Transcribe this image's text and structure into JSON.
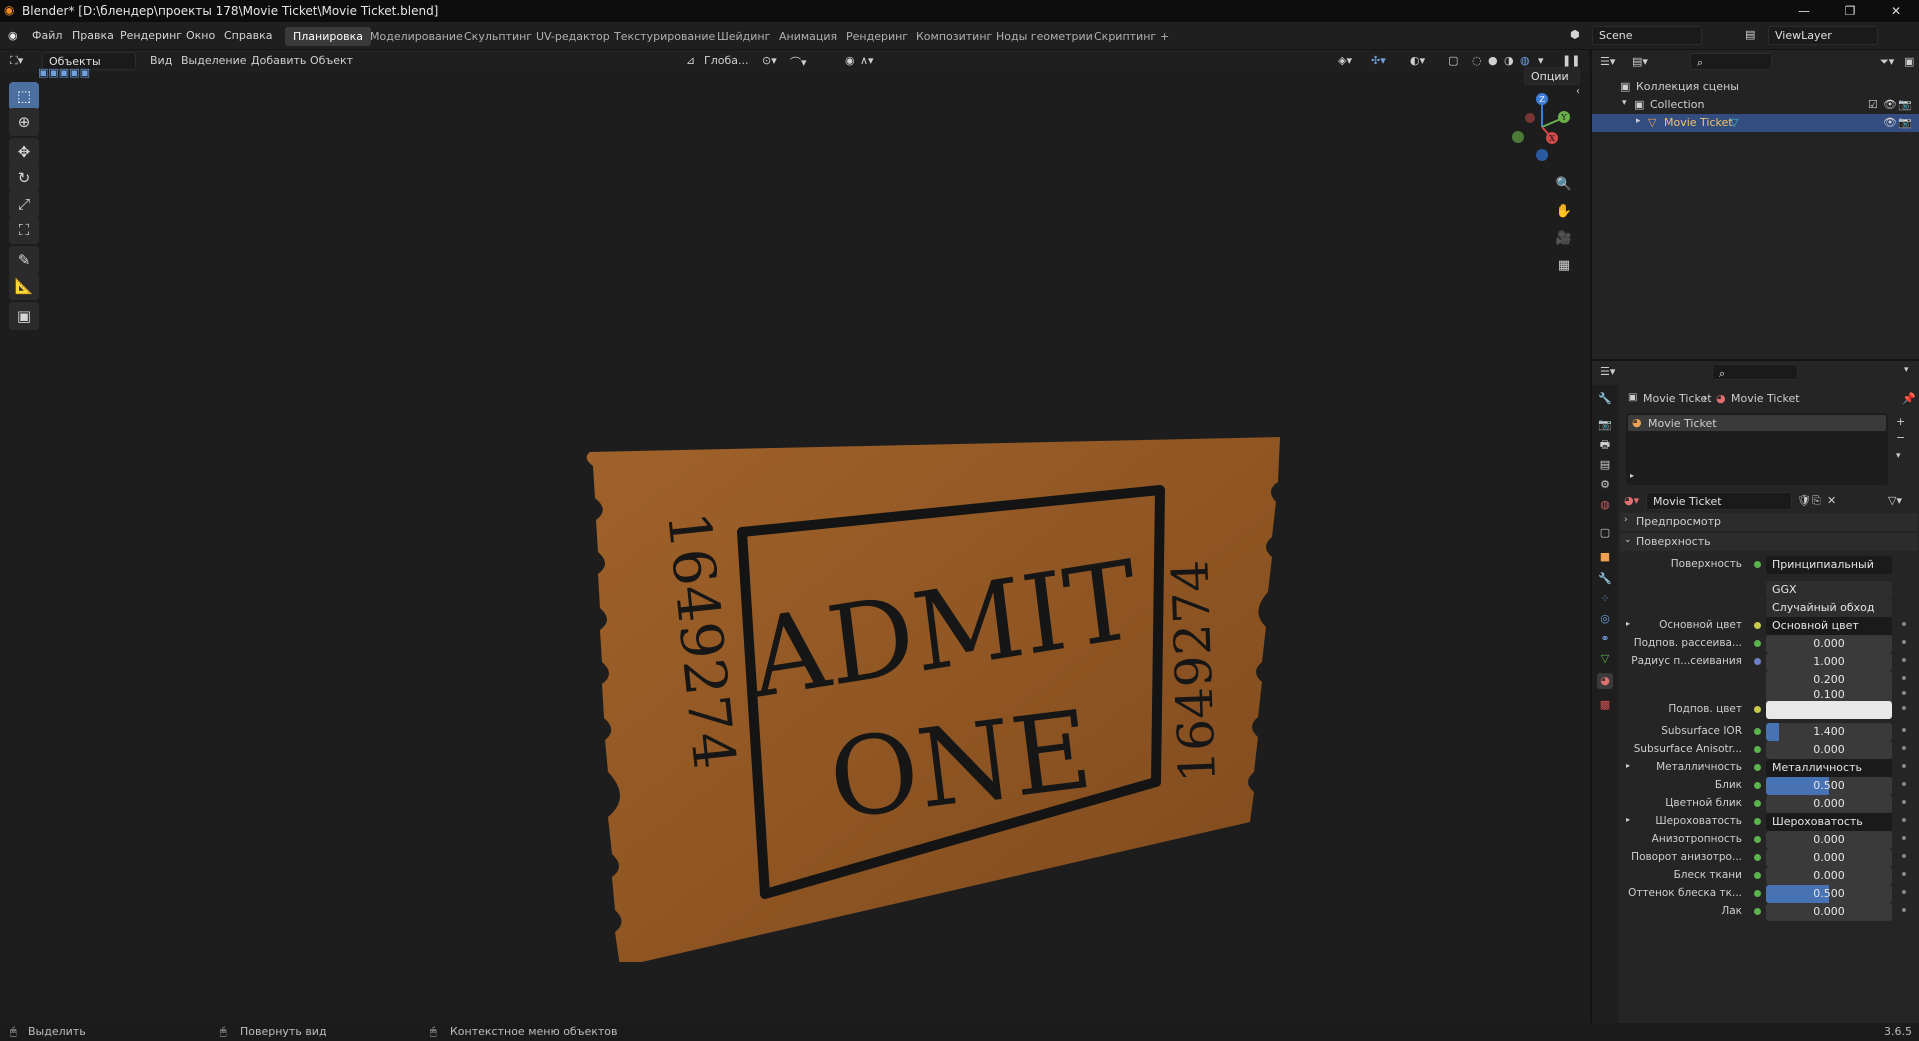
{
  "window": {
    "title": "Blender* [D:\\блендер\\проекты 178\\Movie Ticket\\Movie Ticket.blend]",
    "controls": [
      "—",
      "❐",
      "✕"
    ]
  },
  "menu": [
    "Файл",
    "Правка",
    "Рендеринг",
    "Окно",
    "Справка"
  ],
  "workspaces": [
    "Планировка",
    "Моделирование",
    "Скульптинг",
    "UV-редактор",
    "Текстурирование",
    "Шейдинг",
    "Анимация",
    "Рендеринг",
    "Композитинг",
    "Ноды геометрии",
    "Скриптинг",
    "+"
  ],
  "active_workspace": "Планировка",
  "scene": {
    "name": "Scene",
    "view_layer": "ViewLayer"
  },
  "viewport_header": {
    "mode": "Объекты",
    "menus": [
      "Вид",
      "Выделение",
      "Добавить",
      "Объект"
    ],
    "transform_orientation": "Глоба...",
    "options": "Опции"
  },
  "tools": [
    {
      "name": "select-box-tool",
      "glyph": "⬚"
    },
    {
      "name": "cursor-tool",
      "glyph": "⊕"
    },
    {
      "name": "move-tool",
      "glyph": "✥"
    },
    {
      "name": "rotate-tool",
      "glyph": "↻"
    },
    {
      "name": "scale-tool",
      "glyph": "⤢"
    },
    {
      "name": "transform-tool",
      "glyph": "⛶"
    },
    {
      "name": "annotate-tool",
      "glyph": "✎"
    },
    {
      "name": "measure-tool",
      "glyph": "📐"
    },
    {
      "name": "add-cube-tool",
      "glyph": "▣"
    }
  ],
  "ticket": {
    "main_text_1": "ADMIT",
    "main_text_2": "ONE",
    "serial_left": "1649274",
    "serial_right": "1649274",
    "color": "#9b5a24"
  },
  "gizmo": {
    "z": "Z",
    "y": "Y",
    "x": "X"
  },
  "outliner": {
    "root": "Коллекция сцены",
    "collection": "Collection",
    "object": "Movie Ticket"
  },
  "properties": {
    "breadcrumb_object": "Movie Ticket",
    "breadcrumb_material": "Movie Ticket",
    "slot": "Movie Ticket",
    "material_name": "Movie Ticket",
    "preview_label": "Предпросмотр",
    "surface_label": "Поверхность",
    "surface_shader_label": "Поверхность",
    "surface_shader": "Принципиальный BSDF",
    "distribution": "GGX",
    "subsurface_method": "Случайный обход",
    "rows": [
      {
        "label": "Основной цвет",
        "value": "Основной цвет",
        "type": "link",
        "dot": "yellow"
      },
      {
        "label": "Подпов. рассеива...",
        "value": "0.000",
        "type": "num",
        "dot": "green",
        "fill": 0
      },
      {
        "label": "Радиус п...сеивания",
        "value": "1.000",
        "type": "num",
        "dot": "blue",
        "fill": 0
      },
      {
        "label": "",
        "value": "0.200",
        "type": "num",
        "dot": "none",
        "fill": 0
      },
      {
        "label": "",
        "value": "0.100",
        "type": "num",
        "dot": "none",
        "fill": 0
      },
      {
        "label": "Подпов. цвет",
        "value": "",
        "type": "color",
        "dot": "yellow"
      },
      {
        "label": "Subsurface IOR",
        "value": "1.400",
        "type": "num",
        "dot": "green",
        "fill": 0.1
      },
      {
        "label": "Subsurface Anisotr...",
        "value": "0.000",
        "type": "num",
        "dot": "green",
        "fill": 0
      },
      {
        "label": "Металличность",
        "value": "Металличность",
        "type": "link",
        "dot": "green"
      },
      {
        "label": "Блик",
        "value": "0.500",
        "type": "num",
        "dot": "green",
        "fill": 0.5
      },
      {
        "label": "Цветной блик",
        "value": "0.000",
        "type": "num",
        "dot": "green",
        "fill": 0
      },
      {
        "label": "Шероховатость",
        "value": "Шероховатость",
        "type": "link",
        "dot": "green"
      },
      {
        "label": "Анизотропность",
        "value": "0.000",
        "type": "num",
        "dot": "green",
        "fill": 0
      },
      {
        "label": "Поворот анизотро...",
        "value": "0.000",
        "type": "num",
        "dot": "green",
        "fill": 0
      },
      {
        "label": "Блеск ткани",
        "value": "0.000",
        "type": "num",
        "dot": "green",
        "fill": 0
      },
      {
        "label": "Оттенок блеска тк...",
        "value": "0.500",
        "type": "num",
        "dot": "green",
        "fill": 0.5
      },
      {
        "label": "Лак",
        "value": "0.000",
        "type": "num",
        "dot": "green",
        "fill": 0
      }
    ]
  },
  "status": {
    "select": "Выделить",
    "rotate": "Повернуть вид",
    "context": "Контекстное меню объектов",
    "version": "3.6.5"
  }
}
